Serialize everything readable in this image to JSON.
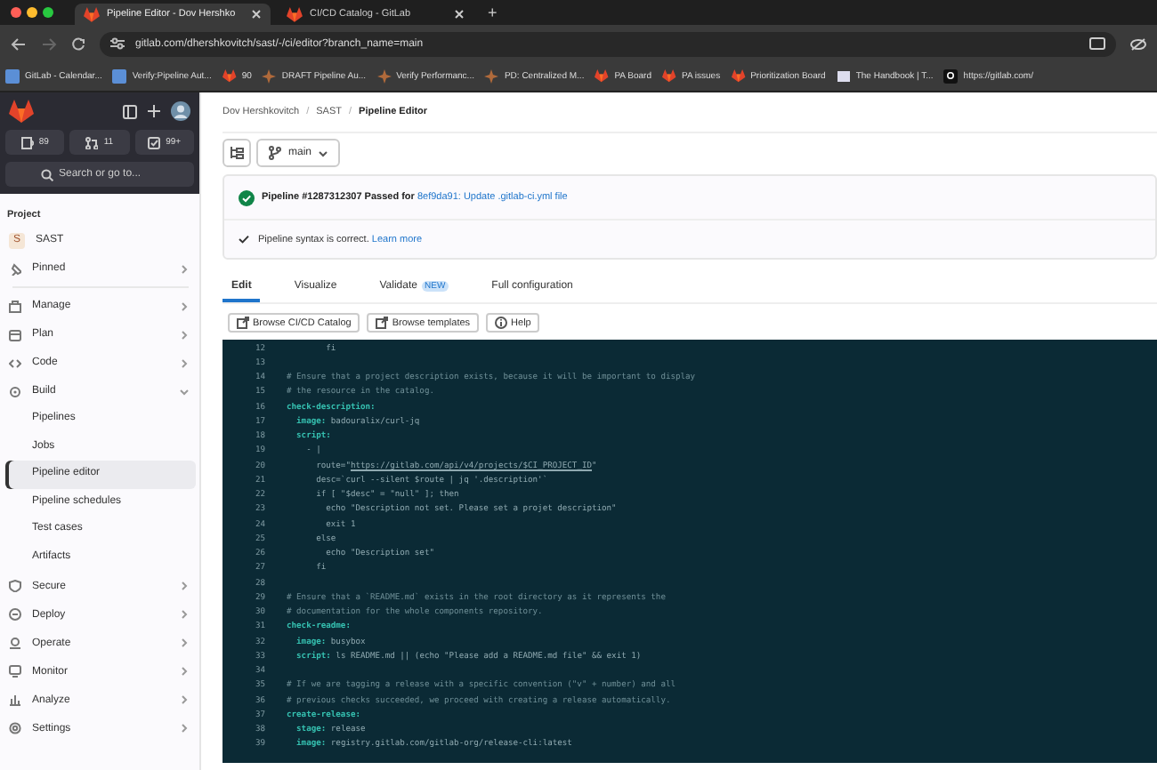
{
  "browser": {
    "tabs": [
      {
        "title": "Pipeline Editor - Dov Hershko",
        "selected": true
      },
      {
        "title": "CI/CD Catalog - GitLab",
        "selected": false
      }
    ],
    "new_tab": "+",
    "url": "gitlab.com/dhershkovitch/sast/-/ci/editor?branch_name=main",
    "bookmarks": [
      {
        "label": "GitLab - Calendar..."
      },
      {
        "label": "Verify:Pipeline Aut..."
      },
      {
        "label": "90"
      },
      {
        "label": "DRAFT Pipeline Au..."
      },
      {
        "label": "Verify Performanc..."
      },
      {
        "label": "PD: Centralized M..."
      },
      {
        "label": "PA Board"
      },
      {
        "label": "PA issues"
      },
      {
        "label": "Prioritization Board"
      },
      {
        "label": "The Handbook | T..."
      },
      {
        "label": "https://gitlab.com/"
      }
    ]
  },
  "sidebar": {
    "counts": [
      {
        "value": "89"
      },
      {
        "value": "11"
      },
      {
        "value": "99+"
      }
    ],
    "search": {
      "placeholder": "Search or go to..."
    },
    "heading": "Project",
    "items": [
      {
        "kind": "project",
        "avatar": "S",
        "label": "SAST"
      },
      {
        "kind": "section",
        "label": "Pinned",
        "expanded": false
      },
      {
        "kind": "section",
        "label": "Manage",
        "expanded": false
      },
      {
        "kind": "section",
        "label": "Plan",
        "expanded": false
      },
      {
        "kind": "section",
        "label": "Code",
        "expanded": false
      },
      {
        "kind": "section",
        "label": "Build",
        "expanded": true,
        "children": [
          {
            "label": "Pipelines",
            "selected": false
          },
          {
            "label": "Jobs",
            "selected": false
          },
          {
            "label": "Pipeline editor",
            "selected": true
          },
          {
            "label": "Pipeline schedules",
            "selected": false
          },
          {
            "label": "Test cases",
            "selected": false
          },
          {
            "label": "Artifacts",
            "selected": false
          }
        ]
      },
      {
        "kind": "section",
        "label": "Secure",
        "expanded": false
      },
      {
        "kind": "section",
        "label": "Deploy",
        "expanded": false
      },
      {
        "kind": "section",
        "label": "Operate",
        "expanded": false
      },
      {
        "kind": "section",
        "label": "Monitor",
        "expanded": false
      },
      {
        "kind": "section",
        "label": "Analyze",
        "expanded": false
      },
      {
        "kind": "section",
        "label": "Settings",
        "expanded": false
      }
    ]
  },
  "breadcrumb": [
    "Dov Hershkovitch",
    "SAST",
    "Pipeline Editor"
  ],
  "breadcrumb_separator": "/",
  "branch": "main",
  "pipeline": {
    "passed": true,
    "text": "Pipeline #1287312307 Passed for ",
    "link": "8ef9da91: Update .gitlab-ci.yml file"
  },
  "validation": {
    "text": "Pipeline syntax is correct.",
    "link": "Learn more"
  },
  "tabs": [
    {
      "label": "Edit",
      "selected": true
    },
    {
      "label": "Visualize",
      "selected": false
    },
    {
      "label": "Validate",
      "badge": "NEW",
      "selected": false
    },
    {
      "label": "Full configuration",
      "selected": false
    }
  ],
  "actions": [
    {
      "label": "Browse CI/CD Catalog",
      "kind": "external"
    },
    {
      "label": "Browse templates",
      "kind": "external"
    },
    {
      "label": "Help",
      "kind": "help"
    }
  ],
  "code": [
    {
      "number": "12",
      "tokens": [
        {
          "kind": "plain",
          "t": "        fi"
        }
      ]
    },
    {
      "number": "13"
    },
    {
      "number": "14",
      "tokens": [
        {
          "kind": "comment",
          "t": "# Ensure that a project description exists, because it will be important to display"
        }
      ]
    },
    {
      "number": "15",
      "tokens": [
        {
          "kind": "comment",
          "t": "# the resource in the catalog."
        }
      ]
    },
    {
      "number": "16",
      "tokens": [
        {
          "kind": "key",
          "t": "check-description:"
        }
      ]
    },
    {
      "number": "17",
      "tokens": [
        {
          "kind": "key",
          "t": "  image:"
        },
        {
          "kind": "plain",
          "t": " badouralix/curl-jq"
        }
      ]
    },
    {
      "number": "18",
      "tokens": [
        {
          "kind": "key",
          "t": "  script:"
        }
      ]
    },
    {
      "number": "19",
      "tokens": [
        {
          "kind": "plain",
          "t": "    - |"
        }
      ]
    },
    {
      "number": "20",
      "tokens": [
        {
          "kind": "plain",
          "t": "      route=\""
        },
        {
          "kind": "link",
          "t": "https://gitlab.com/api/v4/projects/$CI_PROJECT_ID"
        },
        {
          "kind": "plain",
          "t": "\""
        }
      ]
    },
    {
      "number": "21",
      "tokens": [
        {
          "kind": "plain",
          "t": "      desc=`curl --silent $route | jq '.description'`"
        }
      ]
    },
    {
      "number": "22",
      "tokens": [
        {
          "kind": "plain",
          "t": "      if [ \"$desc\" = \"null\" ]; then"
        }
      ]
    },
    {
      "number": "23",
      "tokens": [
        {
          "kind": "plain",
          "t": "        echo \"Description not set. Please set a projet description\""
        }
      ]
    },
    {
      "number": "24",
      "tokens": [
        {
          "kind": "plain",
          "t": "        exit 1"
        }
      ]
    },
    {
      "number": "25",
      "tokens": [
        {
          "kind": "plain",
          "t": "      else"
        }
      ]
    },
    {
      "number": "26",
      "tokens": [
        {
          "kind": "plain",
          "t": "        echo \"Description set\""
        }
      ]
    },
    {
      "number": "27",
      "tokens": [
        {
          "kind": "plain",
          "t": "      fi"
        }
      ]
    },
    {
      "number": "28"
    },
    {
      "number": "29",
      "tokens": [
        {
          "kind": "comment",
          "t": "# Ensure that a `README.md` exists in the root directory as it represents the"
        }
      ]
    },
    {
      "number": "30",
      "tokens": [
        {
          "kind": "comment",
          "t": "# documentation for the whole components repository."
        }
      ]
    },
    {
      "number": "31",
      "tokens": [
        {
          "kind": "key",
          "t": "check-readme:"
        }
      ]
    },
    {
      "number": "32",
      "tokens": [
        {
          "kind": "key",
          "t": "  image:"
        },
        {
          "kind": "plain",
          "t": " busybox"
        }
      ]
    },
    {
      "number": "33",
      "tokens": [
        {
          "kind": "key",
          "t": "  script:"
        },
        {
          "kind": "plain",
          "t": " ls README.md || (echo \"Please add a README.md file\" && exit 1)"
        }
      ]
    },
    {
      "number": "34"
    },
    {
      "number": "35",
      "tokens": [
        {
          "kind": "comment",
          "t": "# If we are tagging a release with a specific convention (\"v\" + number) and all"
        }
      ]
    },
    {
      "number": "36",
      "tokens": [
        {
          "kind": "comment",
          "t": "# previous checks succeeded, we proceed with creating a release automatically."
        }
      ]
    },
    {
      "number": "37",
      "tokens": [
        {
          "kind": "key",
          "t": "create-release:"
        }
      ]
    },
    {
      "number": "38",
      "tokens": [
        {
          "kind": "key",
          "t": "  stage:"
        },
        {
          "kind": "plain",
          "t": " release"
        }
      ]
    },
    {
      "number": "39",
      "tokens": [
        {
          "kind": "key",
          "t": "  image:"
        },
        {
          "kind": "plain",
          "t": " registry.gitlab.com/gitlab-org/release-cli:latest"
        }
      ]
    }
  ]
}
